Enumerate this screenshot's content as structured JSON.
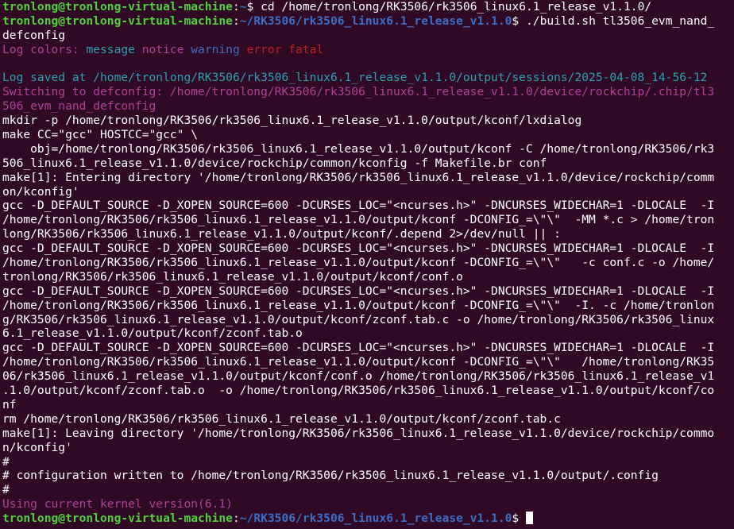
{
  "colors": {
    "background": "#300a24",
    "default": "#ffffff",
    "prompt_user": "#4fd13a",
    "prompt_path": "#3b6ec6",
    "magenta": "#b0419b",
    "cyan": "#2aa1b3",
    "blue": "#3b6ec6",
    "red": "#c01c28"
  },
  "lines": [
    {
      "spans": [
        {
          "t": "tronlong@tronlong-virtual-machine",
          "c": "user"
        },
        {
          "t": ":",
          "c": "dim"
        },
        {
          "t": "~",
          "c": "path"
        },
        {
          "t": "$ cd /home/tronlong/RK3506/rk3506_linux6.1_release_v1.1.0/",
          "c": "dim"
        }
      ]
    },
    {
      "spans": [
        {
          "t": "tronlong@tronlong-virtual-machine",
          "c": "user"
        },
        {
          "t": ":",
          "c": "dim"
        },
        {
          "t": "~/RK3506/rk3506_linux6.1_release_v1.1.0",
          "c": "path"
        },
        {
          "t": "$ ./build.sh tl3506_evm_nand_",
          "c": "dim"
        }
      ]
    },
    {
      "spans": [
        {
          "t": "defconfig",
          "c": "dim"
        }
      ]
    },
    {
      "spans": [
        {
          "t": "Log colors: ",
          "c": "magenta"
        },
        {
          "t": "message ",
          "c": "cyan"
        },
        {
          "t": "notice ",
          "c": "magenta"
        },
        {
          "t": "warning ",
          "c": "blue"
        },
        {
          "t": "error ",
          "c": "red"
        },
        {
          "t": "fatal",
          "c": "red"
        }
      ]
    },
    {
      "spans": [
        {
          "t": "",
          "c": "dim"
        }
      ]
    },
    {
      "spans": [
        {
          "t": "Log saved at /home/tronlong/RK3506/rk3506_linux6.1_release_v1.1.0/output/sessions/2025-04-08_14-56-12",
          "c": "cyan"
        }
      ]
    },
    {
      "spans": [
        {
          "t": "Switching to defconfig: /home/tronlong/RK3506/rk3506_linux6.1_release_v1.1.0/device/rockchip/.chip/tl3",
          "c": "magenta"
        }
      ]
    },
    {
      "spans": [
        {
          "t": "506_evm_nand_defconfig",
          "c": "magenta"
        }
      ]
    },
    {
      "spans": [
        {
          "t": "mkdir -p /home/tronlong/RK3506/rk3506_linux6.1_release_v1.1.0/output/kconf/lxdialog",
          "c": "dim"
        }
      ]
    },
    {
      "spans": [
        {
          "t": "make CC=\"gcc\" HOSTCC=\"gcc\" \\",
          "c": "dim"
        }
      ]
    },
    {
      "spans": [
        {
          "t": "    obj=/home/tronlong/RK3506/rk3506_linux6.1_release_v1.1.0/output/kconf -C /home/tronlong/RK3506/rk3",
          "c": "dim"
        }
      ]
    },
    {
      "spans": [
        {
          "t": "506_linux6.1_release_v1.1.0/device/rockchip/common/kconfig -f Makefile.br conf",
          "c": "dim"
        }
      ]
    },
    {
      "spans": [
        {
          "t": "make[1]: Entering directory '/home/tronlong/RK3506/rk3506_linux6.1_release_v1.1.0/device/rockchip/comm",
          "c": "dim"
        }
      ]
    },
    {
      "spans": [
        {
          "t": "on/kconfig'",
          "c": "dim"
        }
      ]
    },
    {
      "spans": [
        {
          "t": "gcc -D_DEFAULT_SOURCE -D_XOPEN_SOURCE=600 -DCURSES_LOC=\"<ncurses.h>\" -DNCURSES_WIDECHAR=1 -DLOCALE  -I",
          "c": "dim"
        }
      ]
    },
    {
      "spans": [
        {
          "t": "/home/tronlong/RK3506/rk3506_linux6.1_release_v1.1.0/output/kconf -DCONFIG_=\\\"\\\"  -MM *.c > /home/tron",
          "c": "dim"
        }
      ]
    },
    {
      "spans": [
        {
          "t": "long/RK3506/rk3506_linux6.1_release_v1.1.0/output/kconf/.depend 2>/dev/null || :",
          "c": "dim"
        }
      ]
    },
    {
      "spans": [
        {
          "t": "gcc -D_DEFAULT_SOURCE -D_XOPEN_SOURCE=600 -DCURSES_LOC=\"<ncurses.h>\" -DNCURSES_WIDECHAR=1 -DLOCALE  -I",
          "c": "dim"
        }
      ]
    },
    {
      "spans": [
        {
          "t": "/home/tronlong/RK3506/rk3506_linux6.1_release_v1.1.0/output/kconf -DCONFIG_=\\\"\\\"   -c conf.c -o /home/",
          "c": "dim"
        }
      ]
    },
    {
      "spans": [
        {
          "t": "tronlong/RK3506/rk3506_linux6.1_release_v1.1.0/output/kconf/conf.o",
          "c": "dim"
        }
      ]
    },
    {
      "spans": [
        {
          "t": "gcc -D_DEFAULT_SOURCE -D_XOPEN_SOURCE=600 -DCURSES_LOC=\"<ncurses.h>\" -DNCURSES_WIDECHAR=1 -DLOCALE  -I",
          "c": "dim"
        }
      ]
    },
    {
      "spans": [
        {
          "t": "/home/tronlong/RK3506/rk3506_linux6.1_release_v1.1.0/output/kconf -DCONFIG_=\\\"\\\"  -I. -c /home/tronlon",
          "c": "dim"
        }
      ]
    },
    {
      "spans": [
        {
          "t": "g/RK3506/rk3506_linux6.1_release_v1.1.0/output/kconf/zconf.tab.c -o /home/tronlong/RK3506/rk3506_linux",
          "c": "dim"
        }
      ]
    },
    {
      "spans": [
        {
          "t": "6.1_release_v1.1.0/output/kconf/zconf.tab.o",
          "c": "dim"
        }
      ]
    },
    {
      "spans": [
        {
          "t": "gcc -D_DEFAULT_SOURCE -D_XOPEN_SOURCE=600 -DCURSES_LOC=\"<ncurses.h>\" -DNCURSES_WIDECHAR=1 -DLOCALE  -I",
          "c": "dim"
        }
      ]
    },
    {
      "spans": [
        {
          "t": "/home/tronlong/RK3506/rk3506_linux6.1_release_v1.1.0/output/kconf -DCONFIG_=\\\"\\\"   /home/tronlong/RK35",
          "c": "dim"
        }
      ]
    },
    {
      "spans": [
        {
          "t": "06/rk3506_linux6.1_release_v1.1.0/output/kconf/conf.o /home/tronlong/RK3506/rk3506_linux6.1_release_v1",
          "c": "dim"
        }
      ]
    },
    {
      "spans": [
        {
          "t": ".1.0/output/kconf/zconf.tab.o  -o /home/tronlong/RK3506/rk3506_linux6.1_release_v1.1.0/output/kconf/co",
          "c": "dim"
        }
      ]
    },
    {
      "spans": [
        {
          "t": "nf",
          "c": "dim"
        }
      ]
    },
    {
      "spans": [
        {
          "t": "rm /home/tronlong/RK3506/rk3506_linux6.1_release_v1.1.0/output/kconf/zconf.tab.c",
          "c": "dim"
        }
      ]
    },
    {
      "spans": [
        {
          "t": "make[1]: Leaving directory '/home/tronlong/RK3506/rk3506_linux6.1_release_v1.1.0/device/rockchip/commo",
          "c": "dim"
        }
      ]
    },
    {
      "spans": [
        {
          "t": "n/kconfig'",
          "c": "dim"
        }
      ]
    },
    {
      "spans": [
        {
          "t": "#",
          "c": "dim"
        }
      ]
    },
    {
      "spans": [
        {
          "t": "# configuration written to /home/tronlong/RK3506/rk3506_linux6.1_release_v1.1.0/output/.config",
          "c": "dim"
        }
      ]
    },
    {
      "spans": [
        {
          "t": "#",
          "c": "dim"
        }
      ]
    },
    {
      "spans": [
        {
          "t": "Using current kernel version(6.1)",
          "c": "magenta"
        }
      ]
    },
    {
      "spans": [
        {
          "t": "tronlong@tronlong-virtual-machine",
          "c": "user"
        },
        {
          "t": ":",
          "c": "dim"
        },
        {
          "t": "~/RK3506/rk3506_linux6.1_release_v1.1.0",
          "c": "path"
        },
        {
          "t": "$ ",
          "c": "dim"
        }
      ],
      "cursor": true
    }
  ]
}
